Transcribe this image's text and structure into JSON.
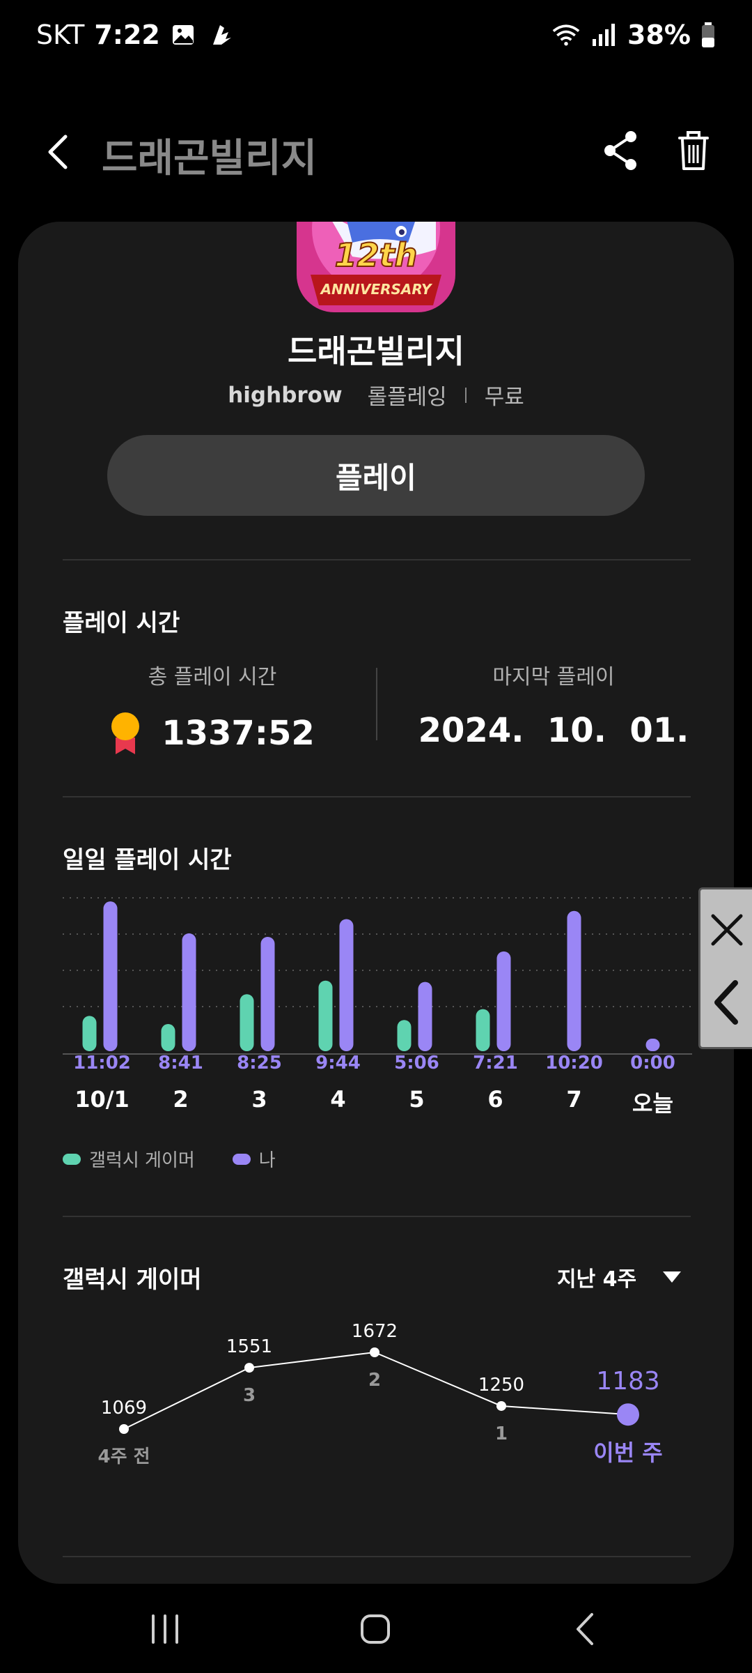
{
  "status_bar": {
    "carrier": "SKT",
    "time": "7:22",
    "battery": "38%"
  },
  "header": {
    "title": "드래곤빌리지"
  },
  "app": {
    "name": "드래곤빌리지",
    "developer": "highbrow",
    "genre": "롤플레잉",
    "price": "무료",
    "icon_text_main": "12th",
    "icon_text_sub": "ANNIVERSARY",
    "play_label": "플레이"
  },
  "playtime": {
    "section_title": "플레이 시간",
    "total_label": "총 플레이 시간",
    "total_value": "1337:52",
    "last_label": "마지막 플레이",
    "last_value": "2024.  10.  01."
  },
  "daily": {
    "section_title": "일일 플레이 시간",
    "legend_gamer": "갤럭시 게이머",
    "legend_me": "나"
  },
  "chart_data": [
    {
      "type": "bar",
      "categories": [
        "10/1",
        "2",
        "3",
        "4",
        "5",
        "6",
        "7",
        "오늘"
      ],
      "time_labels": [
        "11:02",
        "8:41",
        "8:25",
        "9:44",
        "5:06",
        "7:21",
        "10:20",
        "0:00"
      ],
      "series": [
        {
          "name": "갤럭시 게이머",
          "values": [
            2.6,
            2.0,
            4.2,
            5.2,
            2.3,
            3.1,
            0,
            0
          ]
        },
        {
          "name": "나",
          "values": [
            11.03,
            8.68,
            8.42,
            9.73,
            5.1,
            7.35,
            10.33,
            0
          ]
        }
      ],
      "ylim": [
        0,
        11.5
      ],
      "grid": true,
      "colors": {
        "gamer": "#5fd3b0",
        "me": "#9a86f5"
      }
    },
    {
      "type": "line",
      "title": "갤럭시 게이머",
      "period": "지난 4주",
      "categories": [
        "4주 전",
        "3",
        "2",
        "1",
        "이번 주"
      ],
      "values": [
        1069,
        1551,
        1672,
        1250,
        1183
      ],
      "highlight_last": true,
      "colors": {
        "line": "#ffffff",
        "highlight": "#9a86f5"
      }
    }
  ],
  "colors": {
    "background": "#000000",
    "card": "#1a1a1a",
    "accent": "#9a86f5",
    "gamer": "#5fd3b0"
  }
}
